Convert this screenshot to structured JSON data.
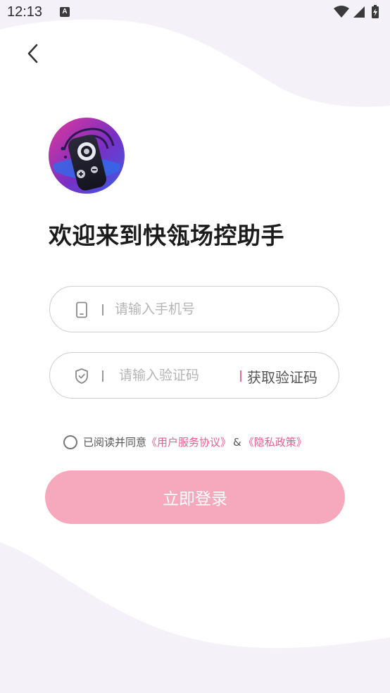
{
  "status_bar": {
    "time": "12:13",
    "notification_glyph": "A",
    "icons": [
      "wifi-icon",
      "signal-icon",
      "battery-icon"
    ]
  },
  "header": {
    "back_icon": "chevron-left-icon"
  },
  "logo": {
    "icon": "remote-control-logo"
  },
  "welcome": {
    "title": "欢迎来到快瓴场控助手"
  },
  "form": {
    "phone": {
      "placeholder": "请输入手机号",
      "value": "",
      "icon": "phone-icon"
    },
    "code": {
      "placeholder": "请输入验证码",
      "value": "",
      "icon": "shield-icon",
      "get_code_label": "获取验证码"
    }
  },
  "agreement": {
    "prefix": "已阅读并同意",
    "terms_link": "《用户服务协议》",
    "amp": "&",
    "privacy_link": "《隐私政策》",
    "checked": false
  },
  "login": {
    "label": "立即登录"
  },
  "colors": {
    "accent": "#e8608c",
    "login_bg": "#f6a9bc",
    "wave": "#f4f2f8"
  }
}
